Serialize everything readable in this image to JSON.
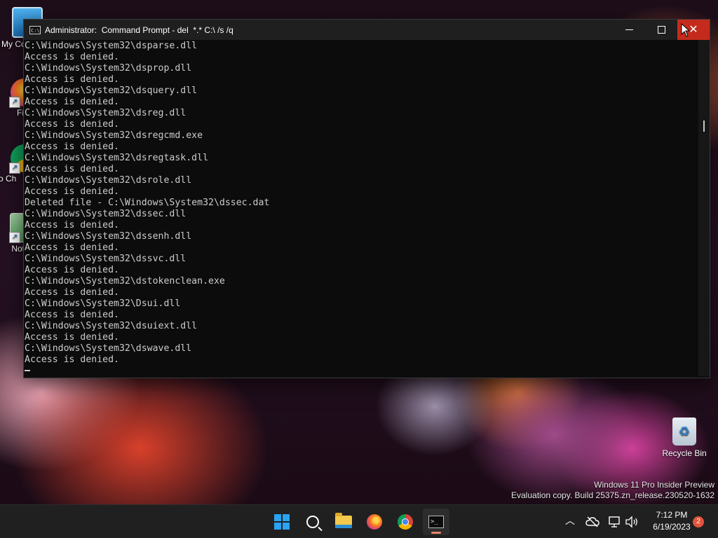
{
  "desktop": {
    "icons": [
      {
        "label": "My Co"
      },
      {
        "label": "Fi"
      },
      {
        "label": "Go Ch"
      },
      {
        "label": "Note"
      }
    ],
    "recycle_bin": {
      "label": "Recycle Bin"
    },
    "watermark": {
      "line1": "Windows 11 Pro Insider Preview",
      "line2": "Evaluation copy. Build 25375.zn_release.230520-1632"
    }
  },
  "window": {
    "title": "Administrator:  Command Prompt - del  *.* C:\\ /s /q",
    "icon": "cmd-icon",
    "lines": [
      "C:\\Windows\\System32\\dsparse.dll",
      "Access is denied.",
      "C:\\Windows\\System32\\dsprop.dll",
      "Access is denied.",
      "C:\\Windows\\System32\\dsquery.dll",
      "Access is denied.",
      "C:\\Windows\\System32\\dsreg.dll",
      "Access is denied.",
      "C:\\Windows\\System32\\dsregcmd.exe",
      "Access is denied.",
      "C:\\Windows\\System32\\dsregtask.dll",
      "Access is denied.",
      "C:\\Windows\\System32\\dsrole.dll",
      "Access is denied.",
      "Deleted file - C:\\Windows\\System32\\dssec.dat",
      "C:\\Windows\\System32\\dssec.dll",
      "Access is denied.",
      "C:\\Windows\\System32\\dssenh.dll",
      "Access is denied.",
      "C:\\Windows\\System32\\dssvc.dll",
      "Access is denied.",
      "C:\\Windows\\System32\\dstokenclean.exe",
      "Access is denied.",
      "C:\\Windows\\System32\\Dsui.dll",
      "Access is denied.",
      "C:\\Windows\\System32\\dsuiext.dll",
      "Access is denied.",
      "C:\\Windows\\System32\\dswave.dll",
      "Access is denied."
    ],
    "controls": {
      "minimize": "minimize-icon",
      "maximize": "maximize-icon",
      "close": "close-icon"
    }
  },
  "taskbar": {
    "apps": [
      "start-icon",
      "search-icon",
      "file-explorer-icon",
      "firefox-icon",
      "chrome-icon",
      "command-prompt-icon"
    ],
    "active_app": "command-prompt-icon",
    "tray": {
      "time": "7:12 PM",
      "date": "6/19/2023",
      "notifications": "2"
    }
  },
  "colors": {
    "console_bg": "#0c0c0c",
    "console_fg": "#cccccc",
    "close_button": "#c42b1c",
    "taskbar": "#202020",
    "badge": "#e2553c"
  }
}
